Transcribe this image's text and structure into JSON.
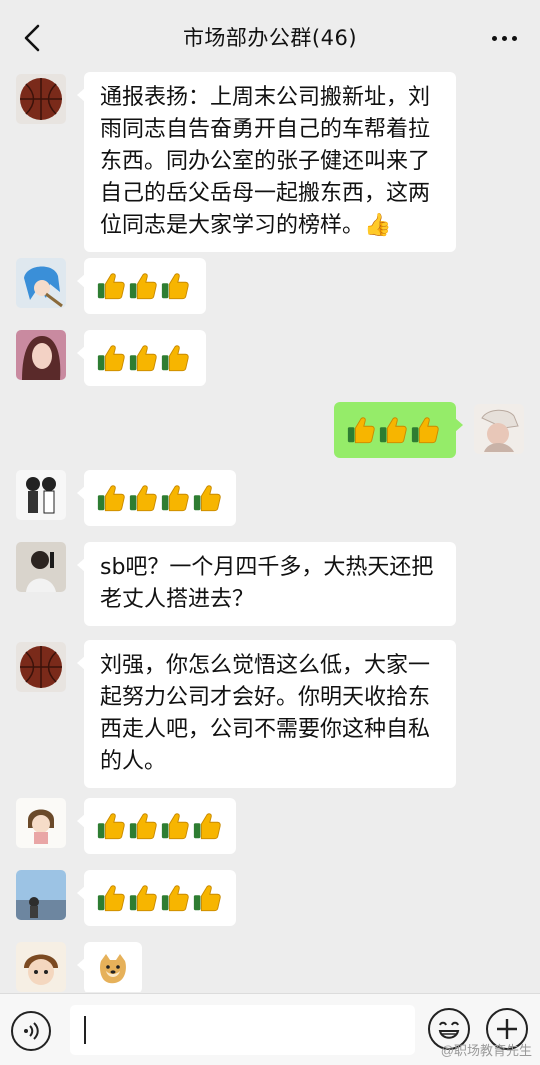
{
  "header": {
    "title": "市场部办公群(46)",
    "back_icon": "chevron-left-icon",
    "more_icon": "more-dots-icon"
  },
  "messages": [
    {
      "side": "left",
      "type": "text",
      "text": "通报表扬：上周末公司搬新址，刘雨同志自告奋勇开自己的车帮着拉东西。同办公室的张子健还叫来了自己的岳父岳母一起搬东西，这两位同志是大家学习的榜样。👍"
    },
    {
      "side": "left",
      "type": "emoji",
      "emoji": "👍👍👍"
    },
    {
      "side": "left",
      "type": "emoji",
      "emoji": "👍👍👍"
    },
    {
      "side": "right",
      "type": "emoji",
      "emoji": "👍👍👍"
    },
    {
      "side": "left",
      "type": "emoji",
      "emoji": "👍👍👍👍"
    },
    {
      "side": "left",
      "type": "text",
      "text": "sb吧？一个月四千多，大热天还把老丈人搭进去？"
    },
    {
      "side": "left",
      "type": "text",
      "text": "刘强，你怎么觉悟这么低，大家一起努力公司才会好。你明天收拾东西走人吧，公司不需要你这种自私的人。"
    },
    {
      "side": "left",
      "type": "emoji",
      "emoji": "👍👍👍👍"
    },
    {
      "side": "left",
      "type": "emoji",
      "emoji": "👍👍👍👍"
    },
    {
      "side": "left",
      "type": "emoji",
      "emoji": "🐶"
    }
  ],
  "footer": {
    "voice_icon": "voice-icon",
    "emoji_icon": "smiley-icon",
    "plus_icon": "plus-icon",
    "input_value": ""
  },
  "watermark": "@职场教育先生",
  "colors": {
    "background": "#ededed",
    "own_bubble": "#95ec69",
    "other_bubble": "#ffffff",
    "thumb": "#f4b400"
  }
}
